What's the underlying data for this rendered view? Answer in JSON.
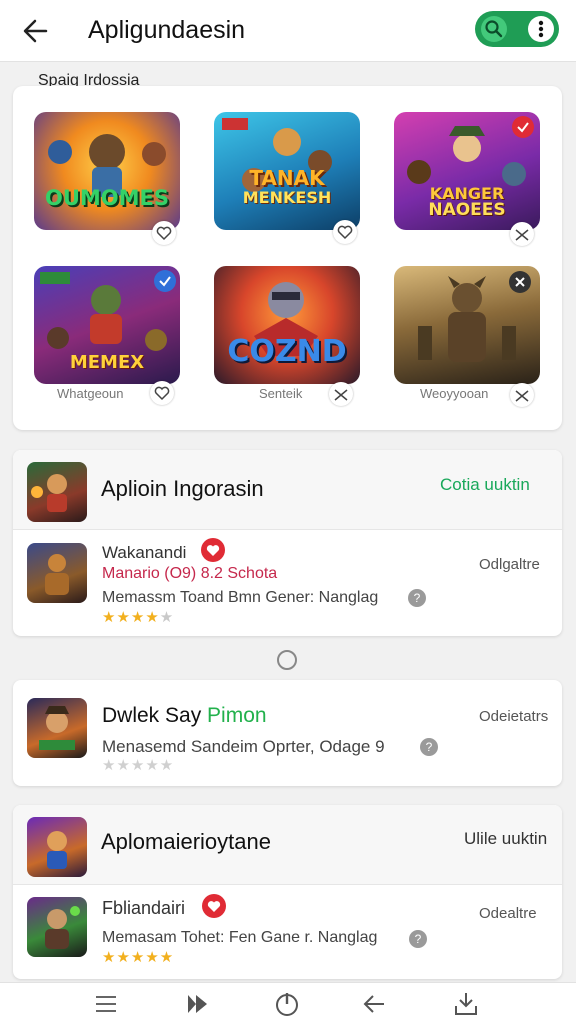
{
  "header": {
    "title": "Apligundaesin",
    "back_icon": "arrow-left-icon",
    "search_icon": "search-icon",
    "more_icon": "more-vertical-icon",
    "accent": "#1f9d55"
  },
  "section_label": "Spaig Irdossia",
  "games": [
    {
      "art_text": "OUMOMES",
      "sub_text": "",
      "caption": ""
    },
    {
      "art_text": "TANAK",
      "sub_text": "MENKESH",
      "caption": ""
    },
    {
      "art_text": "KANGER",
      "sub_text": "NAOEES",
      "caption": ""
    },
    {
      "art_text": "MEMEX",
      "sub_text": "",
      "caption": "Whatgeoun"
    },
    {
      "art_text": "COZND",
      "sub_text": "",
      "caption": "Senteik"
    },
    {
      "art_text": "",
      "sub_text": "",
      "caption": "Weoyyooan"
    }
  ],
  "card1": {
    "title": "Aplioin Ingorasin",
    "link": "Cotia uuktin",
    "item": {
      "name": "Wakanandi",
      "subtitle": "Manario (O9) 8.2 Schota",
      "description": "Memassm Toand Bmn Gener: Nanglag",
      "note": "Odlgaltre",
      "rating": 4
    }
  },
  "divider_icon": "circle-icon",
  "card2": {
    "title_main": "Dwlek Say",
    "title_accent": "Pimon",
    "description": "Menasemd Sandeim Oprter, Odage 9",
    "note": "Odeietatrs",
    "rating": 0
  },
  "card3": {
    "title": "Aplomaierioytane",
    "link": "Ulile uuktin",
    "item": {
      "name": "Fbliandairi",
      "description": "Memasam Tohet: Fen Gane r. Nanglag",
      "note": "Odealtre",
      "rating": 5
    }
  },
  "bottom_nav": [
    "menu-icon",
    "play-icon",
    "power-icon",
    "back-icon",
    "download-icon"
  ]
}
